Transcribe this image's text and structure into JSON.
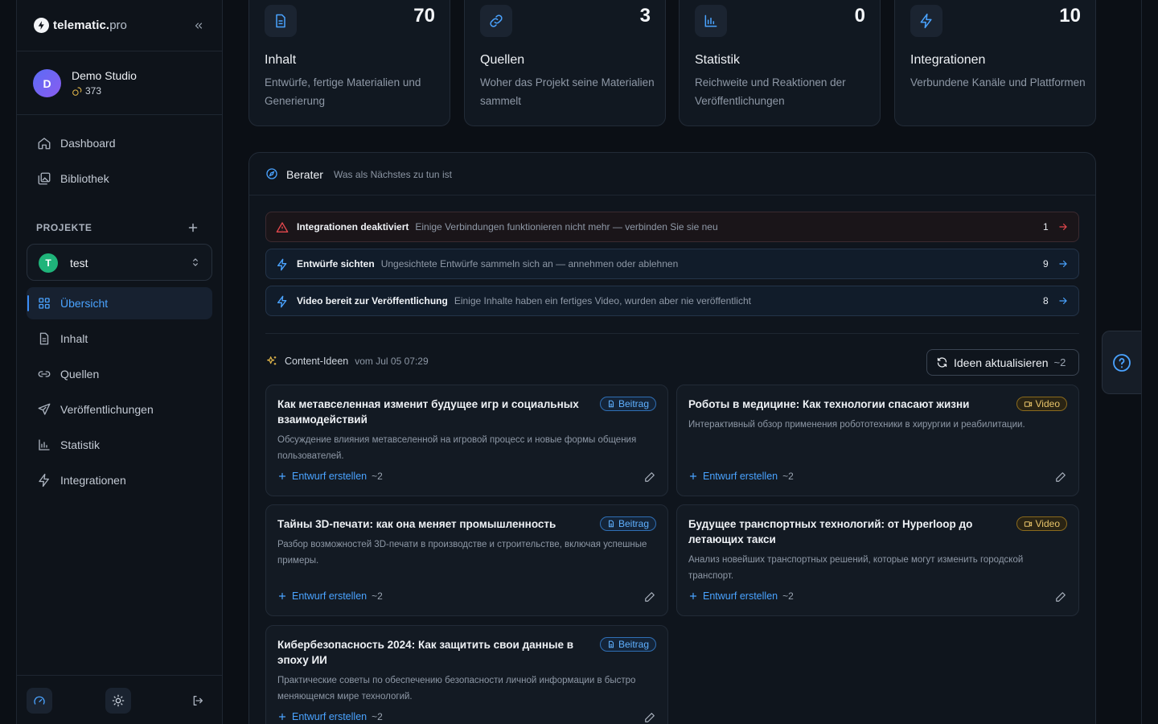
{
  "brand": {
    "name": "telematic.",
    "tld": "pro"
  },
  "account": {
    "initial": "D",
    "name": "Demo Studio",
    "credits": "373"
  },
  "nav": {
    "dashboard": "Dashboard",
    "library": "Bibliothek",
    "projects_label": "PROJEKTE",
    "project": {
      "initial": "T",
      "name": "test"
    },
    "overview": "Übersicht",
    "content": "Inhalt",
    "sources": "Quellen",
    "publications": "Veröffentlichungen",
    "statistics": "Statistik",
    "integrations": "Integrationen"
  },
  "stats": [
    {
      "value": "70",
      "title": "Inhalt",
      "desc": "Entwürfe, fertige Materialien und Generierung",
      "icon": "document-icon"
    },
    {
      "value": "3",
      "title": "Quellen",
      "desc": "Woher das Projekt seine Materialien sammelt",
      "icon": "link-icon"
    },
    {
      "value": "0",
      "title": "Statistik",
      "desc": "Reichweite und Reaktionen der Veröffentlichungen",
      "icon": "bar-chart-icon"
    },
    {
      "value": "10",
      "title": "Integrationen",
      "desc": "Verbundene Kanäle und Plattformen",
      "icon": "bolt-icon"
    }
  ],
  "advisor": {
    "title": "Berater",
    "subtitle": "Was als Nächstes zu tun ist",
    "alerts": [
      {
        "title": "Integrationen deaktiviert",
        "text": "Einige Verbindungen funktionieren nicht mehr — verbinden Sie sie neu",
        "count": "1",
        "level": "danger"
      },
      {
        "title": "Entwürfe sichten",
        "text": "Ungesichtete Entwürfe sammeln sich an — annehmen oder ablehnen",
        "count": "9",
        "level": "info"
      },
      {
        "title": "Video bereit zur Veröffentlichung",
        "text": "Einige Inhalte haben ein fertiges Video, wurden aber nie veröffentlicht",
        "count": "8",
        "level": "info"
      }
    ]
  },
  "ideas": {
    "title": "Content-Ideen",
    "date": "vom Jul 05 07:29",
    "refresh_label": "Ideen aktualisieren",
    "refresh_cost": "~2",
    "action_label": "Entwurf erstellen",
    "action_cost": "~2",
    "items": [
      {
        "title": "Как метавселенная изменит будущее игр и социальных взаимодействий",
        "type": "Beitrag",
        "desc": "Обсуждение влияния метавселенной на игровой процесс и новые формы общения пользователей."
      },
      {
        "title": "Роботы в медицине: Как технологии спасают жизни",
        "type": "Video",
        "desc": "Интерактивный обзор применения робототехники в хирургии и реабилитации."
      },
      {
        "title": "Тайны 3D-печати: как она меняет промышленность",
        "type": "Beitrag",
        "desc": "Разбор возможностей 3D-печати в производстве и строительстве, включая успешные примеры."
      },
      {
        "title": "Будущее транспортных технологий: от Hyperloop до летающих такси",
        "type": "Video",
        "desc": "Анализ новейших транспортных решений, которые могут изменить городской транспорт."
      },
      {
        "title": "Кибербезопасность 2024: Как защитить свои данные в эпоху ИИ",
        "type": "Beitrag",
        "desc": "Практические советы по обеспечению безопасности личной информации в быстро меняющемся мире технологий."
      }
    ]
  },
  "colors": {
    "accent": "#4aa3ff",
    "danger": "#e5484d",
    "video_badge": "#e8c46a",
    "project_dot": "#1fb47a"
  }
}
